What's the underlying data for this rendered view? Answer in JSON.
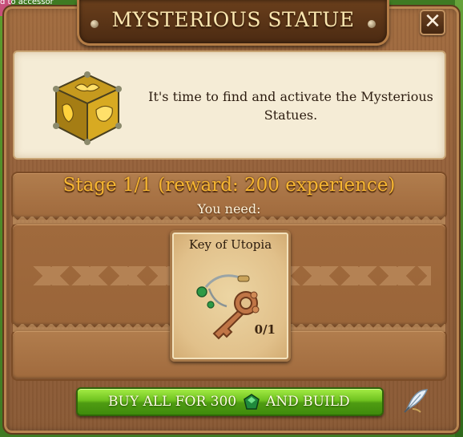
{
  "background": {
    "corner_text": "d to accessor"
  },
  "dialog": {
    "title": "MYSTERIOUS STATUE",
    "close_label": "✕",
    "description": "It's time to find and activate the Mysterious Statues.",
    "stage_text": "Stage 1/1 (reward: 200 experience)",
    "need_label": "You need:",
    "required_items": [
      {
        "name": "Key of Utopia",
        "count": "0/1",
        "icon": "key-icon"
      }
    ],
    "buy_button": {
      "label_before": "BUY ALL FOR 300",
      "label_after": "AND BUILD",
      "currency_icon": "gem-icon"
    },
    "colors": {
      "stage_text": "#f6b632",
      "buy_button": "#6fc21f",
      "title_text": "#fbe7b0"
    }
  }
}
